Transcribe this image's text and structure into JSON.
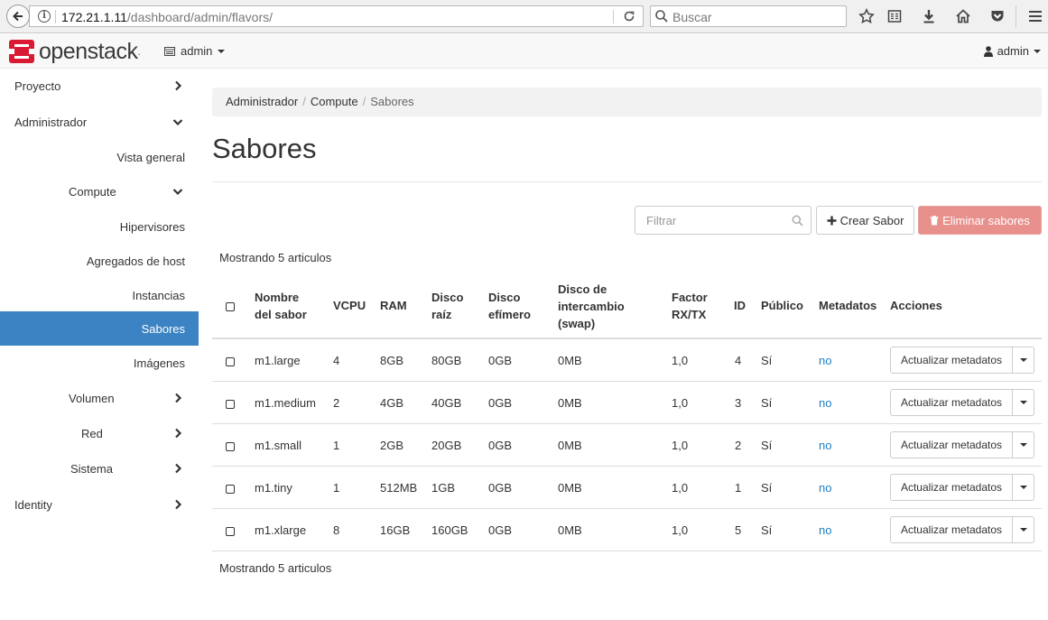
{
  "browser": {
    "url_host": "172.21.1.11",
    "url_path": "/dashboard/admin/flavors/",
    "search_placeholder": "Buscar"
  },
  "navbar": {
    "brand": "openstack",
    "project": "admin",
    "user": "admin"
  },
  "sidebar": {
    "items": [
      {
        "label": "Proyecto"
      },
      {
        "label": "Administrador"
      },
      {
        "label": "Vista general"
      },
      {
        "label": "Compute"
      },
      {
        "label": "Hipervisores"
      },
      {
        "label": "Agregados de host"
      },
      {
        "label": "Instancias"
      },
      {
        "label": "Sabores"
      },
      {
        "label": "Imágenes"
      },
      {
        "label": "Volumen"
      },
      {
        "label": "Red"
      },
      {
        "label": "Sistema"
      },
      {
        "label": "Identity"
      }
    ]
  },
  "breadcrumb": {
    "items": [
      "Administrador",
      "Compute",
      "Sabores"
    ]
  },
  "page": {
    "title": "Sabores",
    "filter_placeholder": "Filtrar",
    "create_label": "Crear Sabor",
    "delete_label": "Eliminar sabores",
    "count_top": "Mostrando 5 articulos",
    "count_bottom": "Mostrando 5 articulos"
  },
  "table": {
    "headers": {
      "name_1": "Nombre",
      "name_2": "del sabor",
      "vcpu": "VCPU",
      "ram": "RAM",
      "root_1": "Disco",
      "root_2": "raíz",
      "eph_1": "Disco",
      "eph_2": "efímero",
      "swap_1": "Disco de",
      "swap_2": "intercambio",
      "swap_3": "(swap)",
      "rxtx_1": "Factor",
      "rxtx_2": "RX/TX",
      "id": "ID",
      "public": "Público",
      "metadata": "Metadatos",
      "actions": "Acciones"
    },
    "action_label": "Actualizar metadatos",
    "rows": [
      {
        "name": "m1.large",
        "vcpu": "4",
        "ram": "8GB",
        "root": "80GB",
        "eph": "0GB",
        "swap": "0MB",
        "rxtx": "1,0",
        "id": "4",
        "public": "Sí",
        "metadata": "no"
      },
      {
        "name": "m1.medium",
        "vcpu": "2",
        "ram": "4GB",
        "root": "40GB",
        "eph": "0GB",
        "swap": "0MB",
        "rxtx": "1,0",
        "id": "3",
        "public": "Sí",
        "metadata": "no"
      },
      {
        "name": "m1.small",
        "vcpu": "1",
        "ram": "2GB",
        "root": "20GB",
        "eph": "0GB",
        "swap": "0MB",
        "rxtx": "1,0",
        "id": "2",
        "public": "Sí",
        "metadata": "no"
      },
      {
        "name": "m1.tiny",
        "vcpu": "1",
        "ram": "512MB",
        "root": "1GB",
        "eph": "0GB",
        "swap": "0MB",
        "rxtx": "1,0",
        "id": "1",
        "public": "Sí",
        "metadata": "no"
      },
      {
        "name": "m1.xlarge",
        "vcpu": "8",
        "ram": "16GB",
        "root": "160GB",
        "eph": "0GB",
        "swap": "0MB",
        "rxtx": "1,0",
        "id": "5",
        "public": "Sí",
        "metadata": "no"
      }
    ]
  },
  "colors": {
    "active_nav": "#3b83c2",
    "link": "#1e7fc5",
    "danger_disabled": "#e8908c",
    "brand_red": "#da1a32"
  }
}
